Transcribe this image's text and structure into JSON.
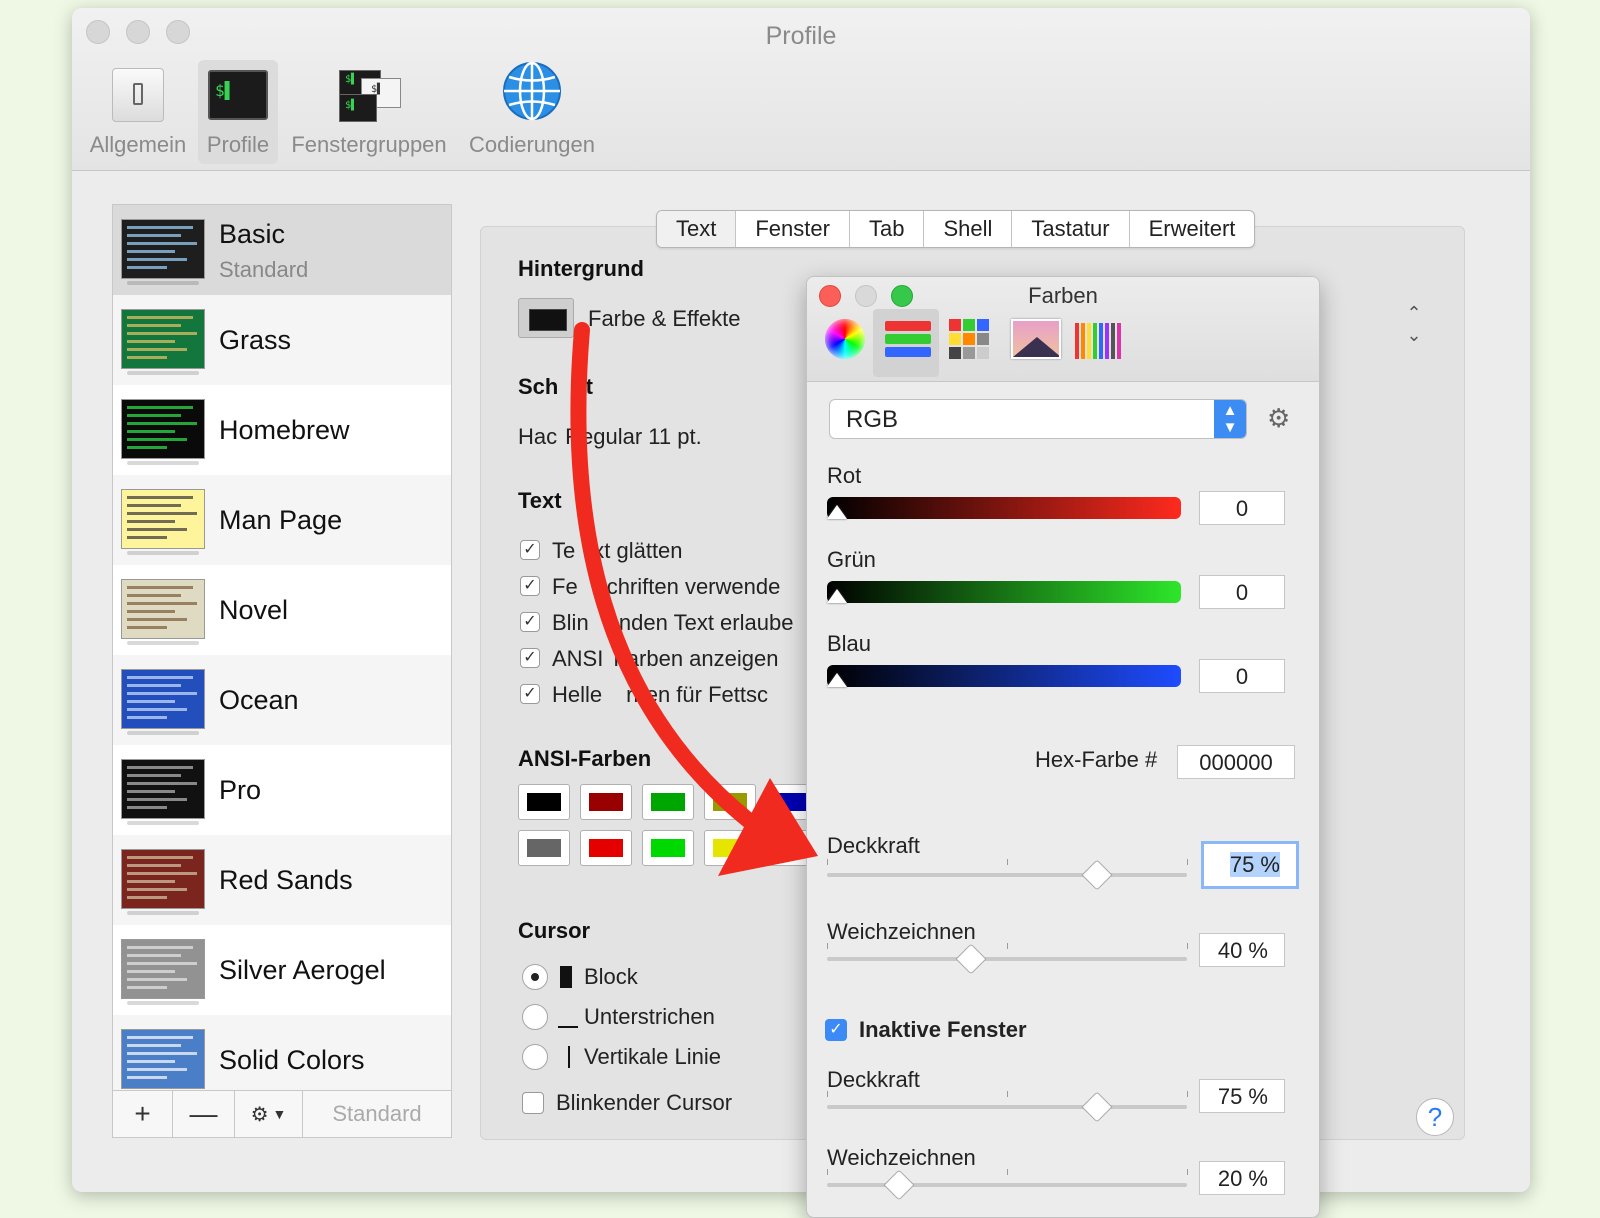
{
  "window": {
    "title": "Profile"
  },
  "toolbar": {
    "items": [
      {
        "label": "Allgemein",
        "icon": "switch-icon"
      },
      {
        "label": "Profile",
        "icon": "terminal-icon"
      },
      {
        "label": "Fenstergruppen",
        "icon": "window-groups-icon"
      },
      {
        "label": "Codierungen",
        "icon": "globe-icon"
      }
    ]
  },
  "sidebar": {
    "profiles": [
      {
        "name": "Basic",
        "subtitle": "Standard",
        "bg": "#1e1e1e",
        "line": "#9ed7ff"
      },
      {
        "name": "Grass",
        "bg": "#13773d",
        "line": "#e8c46a"
      },
      {
        "name": "Homebrew",
        "bg": "#0a0a0a",
        "line": "#2ee84a"
      },
      {
        "name": "Man Page",
        "bg": "#fef49c",
        "line": "#333333"
      },
      {
        "name": "Novel",
        "bg": "#dfdbc3",
        "line": "#7a5a3a"
      },
      {
        "name": "Ocean",
        "bg": "#224fbc",
        "line": "#cfe3ff"
      },
      {
        "name": "Pro",
        "bg": "#111111",
        "line": "#bbbbbb"
      },
      {
        "name": "Red Sands",
        "bg": "#7a251e",
        "line": "#d7c9a7"
      },
      {
        "name": "Silver Aerogel",
        "bg": "#929292",
        "line": "#e8e8e8"
      },
      {
        "name": "Solid Colors",
        "bg": "#4a7ec6",
        "line": "#ffffff"
      }
    ],
    "add_label": "+",
    "remove_label": "—",
    "default_label": "Standard"
  },
  "tabs": [
    "Text",
    "Fenster",
    "Tab",
    "Shell",
    "Tastatur",
    "Erweitert"
  ],
  "settings": {
    "background_heading": "Hintergrund",
    "color_effects": "Farbe & Effekte",
    "font_heading_a": "Sch",
    "font_heading_b": "ft",
    "font_value_a": "Hac",
    "font_value_b": "Regular 11 pt.",
    "text_heading": "Text",
    "checks": [
      "Te",
      "xt glätten",
      "Fe",
      "schriften verwende",
      "Blin",
      "enden Text erlaube",
      "ANSI",
      "Farben anzeigen",
      "Helle",
      "rben für Fettsc"
    ],
    "ansi_heading": "ANSI-Farben",
    "ansi_normal": [
      "#000000",
      "#990000",
      "#00a600",
      "#999900",
      "#0000b2"
    ],
    "ansi_bright": [
      "#666666",
      "#e50000",
      "#00d900",
      "#e5e500",
      "#0000ff"
    ],
    "cursor_heading": "Cursor",
    "cursor_options": [
      "Block",
      "Unterstrichen",
      "Vertikale Linie"
    ],
    "blink_cursor": "Blinkender Cursor",
    "help": "?"
  },
  "colors_panel": {
    "title": "Farben",
    "mode": "RGB",
    "channels": [
      {
        "label": "Rot",
        "value": "0"
      },
      {
        "label": "Grün",
        "value": "0"
      },
      {
        "label": "Blau",
        "value": "0"
      }
    ],
    "hex_label": "Hex-Farbe #",
    "hex_value": "000000",
    "opacity_label": "Deckkraft",
    "opacity_value": "75 %",
    "opacity_level": 0.75,
    "blur_label": "Weichzeichnen",
    "blur_value": "40 %",
    "blur_level": 0.4,
    "inactive_label": "Inaktive Fenster",
    "inactive_opacity_label": "Deckkraft",
    "inactive_opacity_value": "75 %",
    "inactive_opacity_level": 0.75,
    "inactive_blur_label": "Weichzeichnen",
    "inactive_blur_value": "20 %",
    "inactive_blur_level": 0.2
  },
  "colors": {
    "accent": "#3b8af5",
    "arrow": "#f02a1e"
  }
}
